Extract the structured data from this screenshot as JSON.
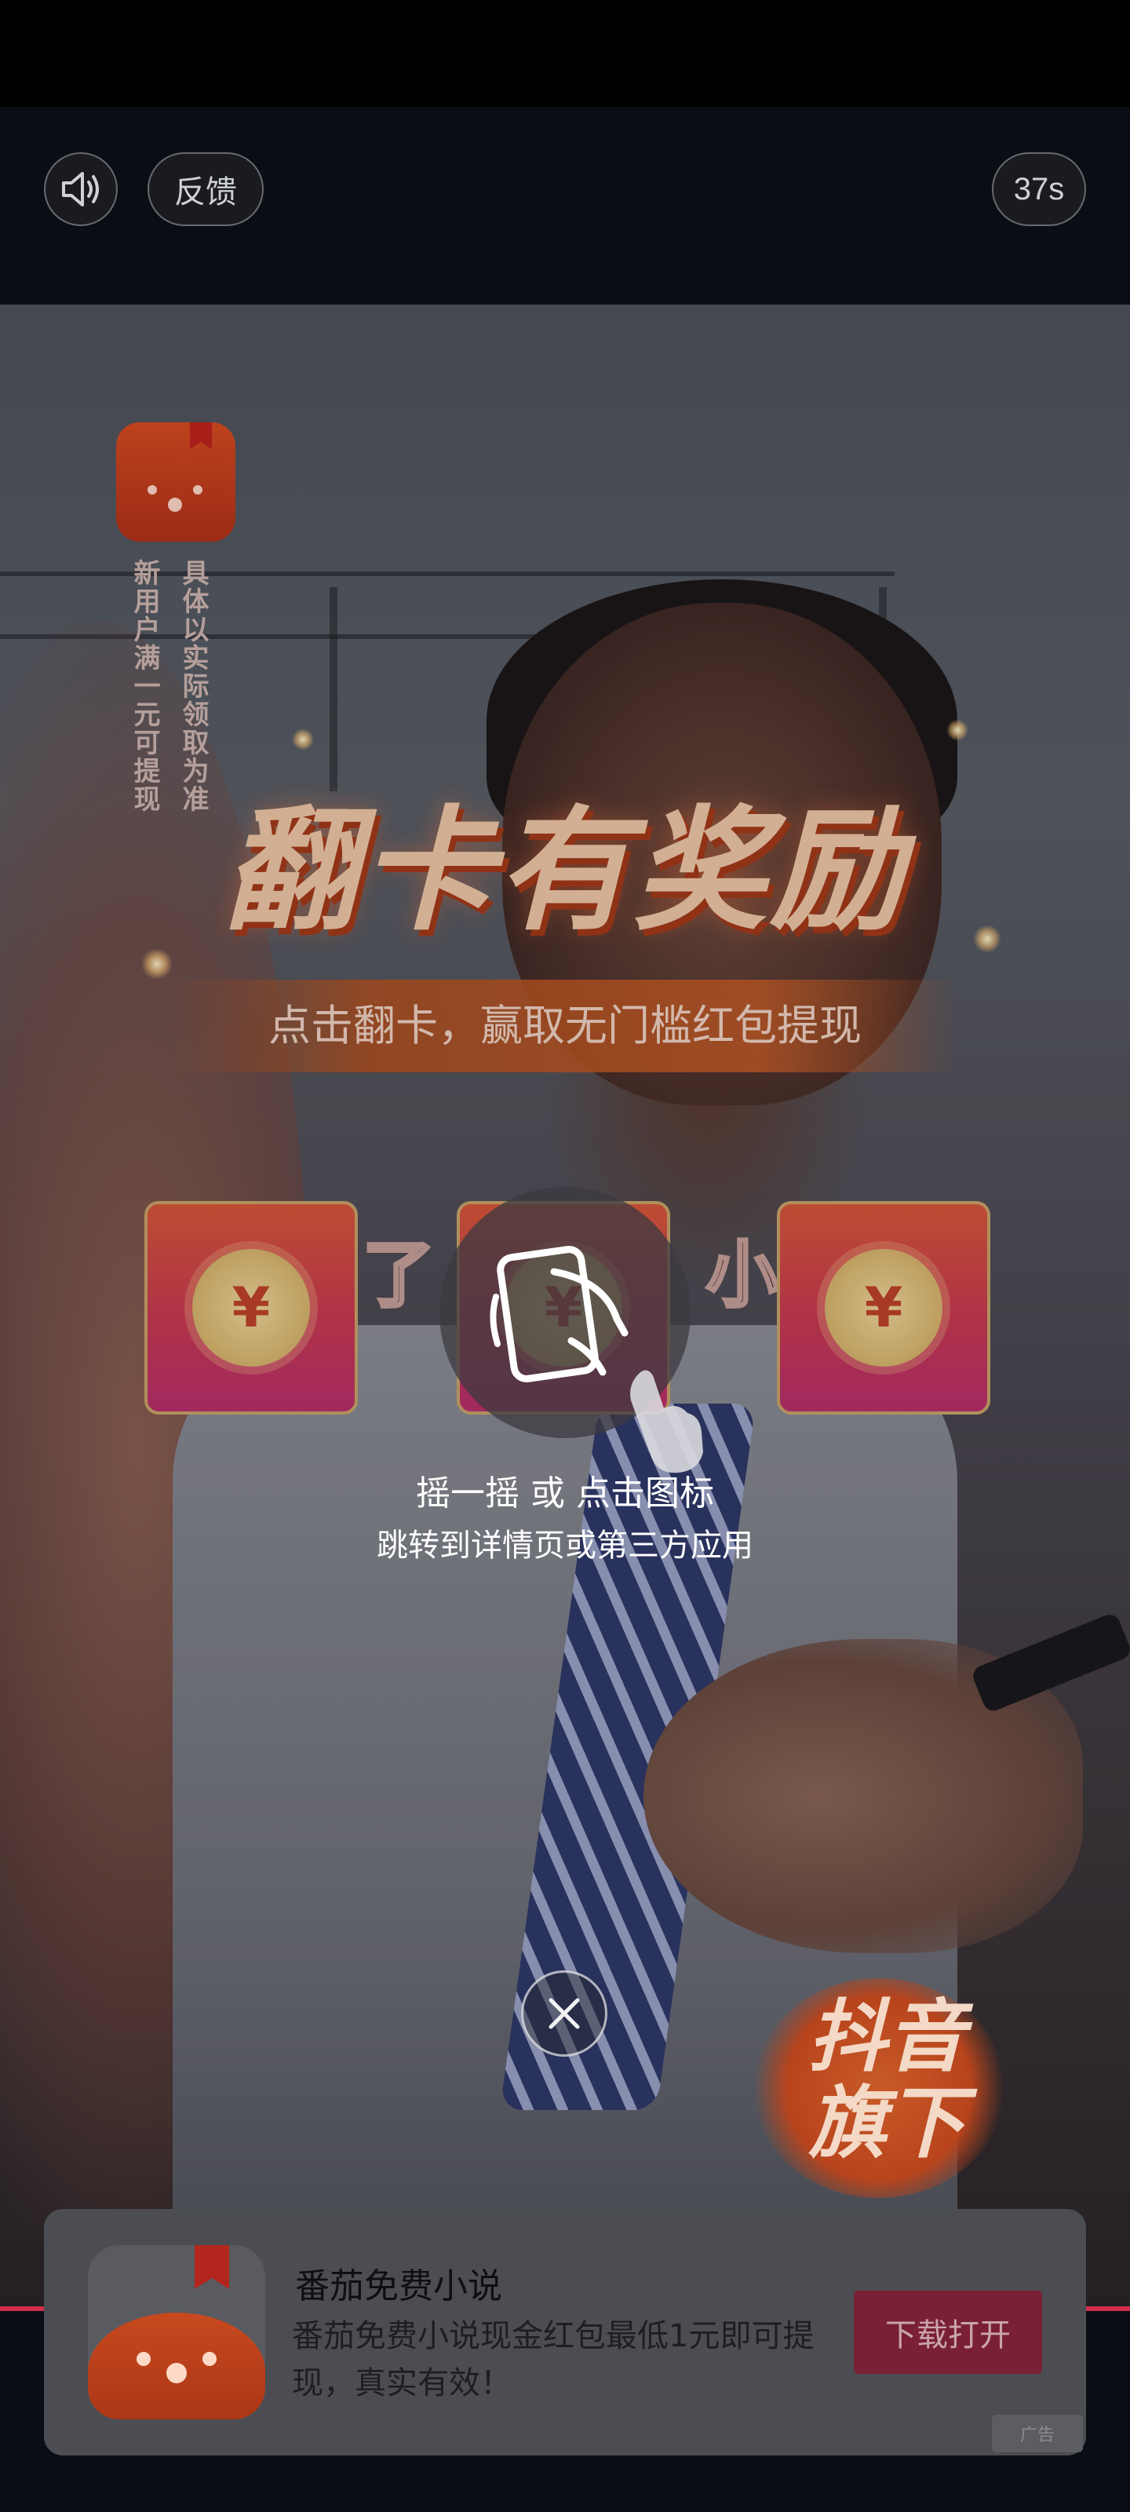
{
  "header": {
    "feedback_label": "反馈",
    "countdown": "37s"
  },
  "video": {
    "vertical_text_left": "新用户满一元可提现",
    "vertical_text_right": "具体以实际领取为准",
    "promo_title": "翻卡有奖励",
    "promo_subtitle": "点击翻卡，赢取无门槛红包提现",
    "card_symbol": "¥",
    "caption_fragments": [
      "了",
      "小"
    ],
    "badge_text": "抖音旗下"
  },
  "overlay": {
    "hint_line1": "摇一摇 或 点击图标",
    "hint_line2": "跳转到详情页或第三方应用"
  },
  "ad": {
    "app_name": "番茄免费小说",
    "description": "番茄免费小说现金红包最低1元即可提现，真实有效！",
    "action_label": "下载打开",
    "tag": "广告"
  },
  "colors": {
    "accent_red": "#d22d4e",
    "tomato": "#c8491f"
  }
}
